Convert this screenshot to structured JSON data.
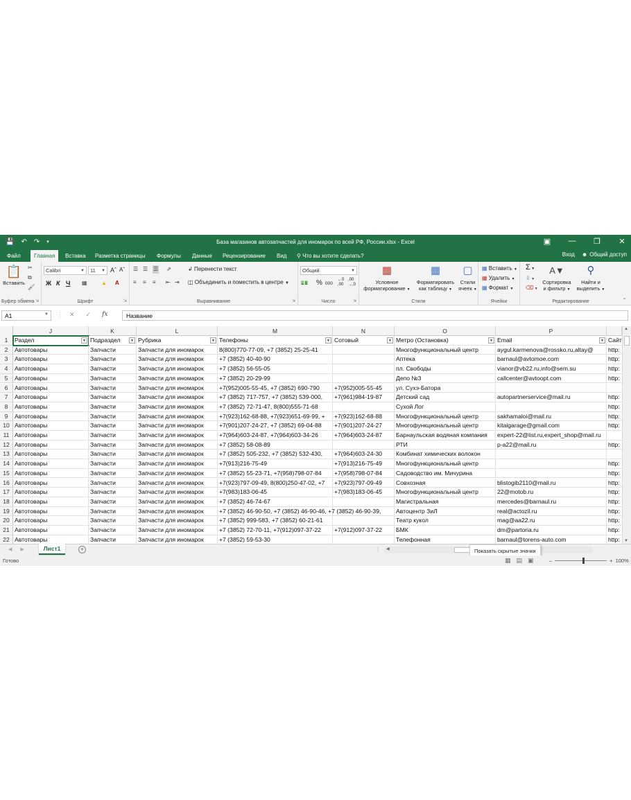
{
  "window": {
    "title": "База магазинов автозапчастей для иномарок по всей РФ, России.xlsx - Excel"
  },
  "tabs": [
    "Файл",
    "Главная",
    "Вставка",
    "Разметка страницы",
    "Формулы",
    "Данные",
    "Рецензирование",
    "Вид"
  ],
  "active_tab": "Главная",
  "tell_me": "Что вы хотите сделать?",
  "signin": "Вход",
  "share": "Общий доступ",
  "ribbon": {
    "clipboard": {
      "paste": "Вставить",
      "label": "Буфер обмена"
    },
    "font": {
      "name": "Calibri",
      "size": "11",
      "bold": "Ж",
      "italic": "К",
      "underline": "Ч",
      "label": "Шрифт"
    },
    "alignment": {
      "wrap": "Перенести текст",
      "merge": "Объединить и поместить в центре",
      "label": "Выравнивание"
    },
    "number": {
      "format": "Общий",
      "label": "Число"
    },
    "styles": {
      "conditional_1": "Условное",
      "conditional_2": "форматирование",
      "table_1": "Форматировать",
      "table_2": "как таблицу",
      "cell_1": "Стили",
      "cell_2": "ячеек",
      "label": "Стили"
    },
    "cells": {
      "insert": "Вставить",
      "delete": "Удалить",
      "format": "Формат",
      "label": "Ячейки"
    },
    "editing": {
      "sort_1": "Сортировка",
      "sort_2": "и фильтр",
      "find_1": "Найти и",
      "find_2": "выделить",
      "label": "Редактирование"
    }
  },
  "formula_bar": {
    "name_box": "A1",
    "fx": "fx",
    "value": "Название"
  },
  "columns": [
    "J",
    "K",
    "L",
    "M",
    "N",
    "O",
    "P"
  ],
  "headers": [
    "Раздел",
    "Подраздел",
    "Рубрика",
    "Телефоны",
    "Сотовый",
    "Метро (Остановка)",
    "Email",
    "Сайт"
  ],
  "rows": [
    {
      "n": "2",
      "c": [
        "Автотовары",
        "Запчасти",
        "Запчасти для иномарок",
        "8(800)770-77-09, +7 (3852) 25-25-41",
        "",
        "Многофункциональный центр",
        "aygul.karmenova@rossko.ru,altay@",
        "http:"
      ]
    },
    {
      "n": "3",
      "c": [
        "Автотовары",
        "Запчасти",
        "Запчасти для иномарок",
        "+7 (3852) 40-40-90",
        "",
        "Аптека",
        "barnaul@avtomoe.com",
        "http:"
      ]
    },
    {
      "n": "4",
      "c": [
        "Автотовары",
        "Запчасти",
        "Запчасти для иномарок",
        "+7 (3852) 56-55-05",
        "",
        "пл. Свободы",
        "vianor@vb22.ru,info@sem.su",
        "http:"
      ]
    },
    {
      "n": "5",
      "c": [
        "Автотовары",
        "Запчасти",
        "Запчасти для иномарок",
        "+7 (3852) 20-29-99",
        "",
        "Депо №3",
        "callcenter@avtoopt.com",
        "http:"
      ]
    },
    {
      "n": "6",
      "c": [
        "Автотовары",
        "Запчасти",
        "Запчасти для иномарок",
        "+7(952)005-55-45, +7 (3852) 690-790",
        "+7(952)005-55-45",
        "ул. Сухэ-Батора",
        "",
        ""
      ]
    },
    {
      "n": "7",
      "c": [
        "Автотовары",
        "Запчасти",
        "Запчасти для иномарок",
        "+7 (3852) 717-757, +7 (3852) 539-000,",
        "+7(961)984-19-87",
        "Детский сад",
        "autopartnerservice@mail.ru",
        "http:"
      ]
    },
    {
      "n": "8",
      "c": [
        "Автотовары",
        "Запчасти",
        "Запчасти для иномарок",
        "+7 (3852) 72-71-47, 8(800)555-71-68",
        "",
        "Сухой Лог",
        "",
        "http:"
      ]
    },
    {
      "n": "9",
      "c": [
        "Автотовары",
        "Запчасти",
        "Запчасти для иномарок",
        "+7(923)162-68-88, +7(923)651-69-99, +",
        "+7(923)162-68-88",
        "Многофункциональный центр",
        "sakhamaloi@mail.ru",
        "http:"
      ]
    },
    {
      "n": "10",
      "c": [
        "Автотовары",
        "Запчасти",
        "Запчасти для иномарок",
        "+7(901)207-24-27, +7 (3852) 69-04-88",
        "+7(901)207-24-27",
        "Многофункциональный центр",
        "kitaigarage@gmail.com",
        "http:"
      ]
    },
    {
      "n": "11",
      "c": [
        "Автотовары",
        "Запчасти",
        "Запчасти для иномарок",
        "+7(964)603-24-87, +7(964)603-34-26",
        "+7(964)603-24-87",
        "Барнаульская водяная компания",
        "expert-22@list.ru,expert_shop@mail.ru",
        ""
      ]
    },
    {
      "n": "12",
      "c": [
        "Автотовары",
        "Запчасти",
        "Запчасти для иномарок",
        "+7 (3852) 58-08-89",
        "",
        "РТИ",
        "p-a22@mail.ru",
        "http:"
      ]
    },
    {
      "n": "13",
      "c": [
        "Автотовары",
        "Запчасти",
        "Запчасти для иномарок",
        "+7 (3852) 505-232, +7 (3852) 532-430,",
        "+7(964)603-24-30",
        "Комбинат химических волокон",
        "",
        ""
      ]
    },
    {
      "n": "14",
      "c": [
        "Автотовары",
        "Запчасти",
        "Запчасти для иномарок",
        "+7(913)216-75-49",
        "+7(913)216-75-49",
        "Многофункциональный центр",
        "",
        "http:"
      ]
    },
    {
      "n": "15",
      "c": [
        "Автотовары",
        "Запчасти",
        "Запчасти для иномарок",
        "+7 (3852) 55-23-71, +7(958)798-07-84",
        "+7(958)798-07-84",
        "Садоводство им. Мичурина",
        "",
        "http:"
      ]
    },
    {
      "n": "16",
      "c": [
        "Автотовары",
        "Запчасти",
        "Запчасти для иномарок",
        "+7(923)797-09-49, 8(800)250-47-02, +7",
        "+7(923)797-09-49",
        "Совхозная",
        "blistogib2110@mail.ru",
        "http:"
      ]
    },
    {
      "n": "17",
      "c": [
        "Автотовары",
        "Запчасти",
        "Запчасти для иномарок",
        "+7(983)183-06-45",
        "+7(983)183-06-45",
        "Многофункциональный центр",
        "22@motob.ru",
        "http:"
      ]
    },
    {
      "n": "18",
      "c": [
        "Автотовары",
        "Запчасти",
        "Запчасти для иномарок",
        "+7 (3852) 46-74-67",
        "",
        "Магистральная",
        "mercedes@barnaul.ru",
        "http:"
      ]
    },
    {
      "n": "19",
      "c": [
        "Автотовары",
        "Запчасти",
        "Запчасти для иномарок",
        "+7 (3852) 46-90-50, +7 (3852) 46-90-46, +7 (3852) 46-90-39,",
        "",
        "Автоцентр ЗиЛ",
        "real@actozil.ru",
        "http:"
      ]
    },
    {
      "n": "20",
      "c": [
        "Автотовары",
        "Запчасти",
        "Запчасти для иномарок",
        "+7 (3852) 999-583, +7 (3852) 60-21-61",
        "",
        "Театр кукол",
        "mag@aa22.ru",
        "http:"
      ]
    },
    {
      "n": "21",
      "c": [
        "Автотовары",
        "Запчасти",
        "Запчасти для иномарок",
        "+7 (3852) 72-70-11, +7(912)097-37-22",
        "+7(912)097-37-22",
        "БМК",
        "dm@partoria.ru",
        "http:"
      ]
    },
    {
      "n": "22",
      "c": [
        "Автотовары",
        "Запчасти",
        "Запчасти для иномарок",
        "+7 (3852) 59-53-30",
        "",
        "Телефонная",
        "barnaul@torens-auto.com",
        "http:"
      ]
    }
  ],
  "sheet_tab": "Лист1",
  "tooltip": "Показать скрытые значки",
  "status": {
    "ready": "Готово",
    "zoom": "100%"
  },
  "colors": {
    "accent": "#217346"
  }
}
